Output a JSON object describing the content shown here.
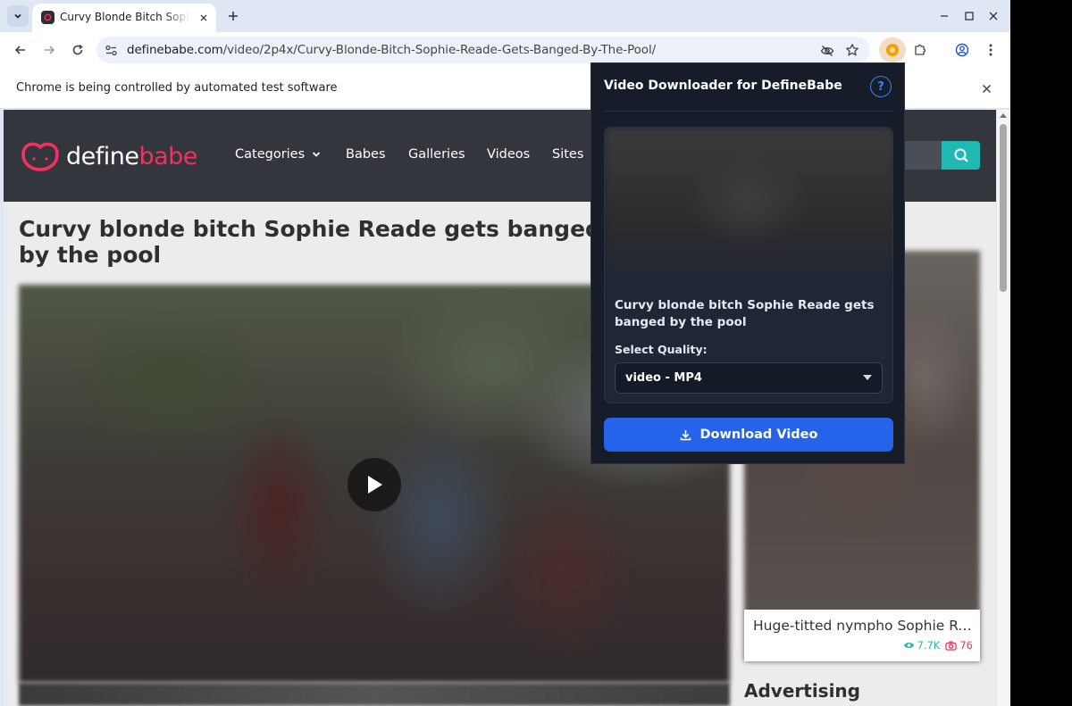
{
  "browser": {
    "tab": {
      "title": "Curvy Blonde Bitch Sophie Reade Gets Banged By The Pool"
    },
    "omnibox": {
      "domain": "definebabe.com",
      "path": "/video/2p4x/Curvy-Blonde-Bitch-Sophie-Reade-Gets-Banged-By-The-Pool/"
    },
    "infobar": {
      "text": "Chrome is being controlled by automated test software"
    }
  },
  "site": {
    "logo": {
      "define": "define",
      "babe": "babe"
    },
    "nav": [
      {
        "label": "Categories"
      },
      {
        "label": "Babes"
      },
      {
        "label": "Galleries"
      },
      {
        "label": "Videos"
      },
      {
        "label": "Sites"
      }
    ],
    "page_title": "Curvy blonde bitch Sophie Reade gets banged by the pool",
    "sidebar_card": {
      "title": "Huge-titted nympho Sophie Reade",
      "views": "7.7K",
      "photos": "76"
    },
    "advertising": "Advertising"
  },
  "popup": {
    "title": "Video Downloader for DefineBabe",
    "help": "?",
    "video_title": "Curvy blonde bitch Sophie Reade gets banged by the pool",
    "quality_label": "Select Quality:",
    "quality_value": "video - MP4",
    "download_label": "Download Video"
  },
  "colors": {
    "brand_pink": "#f0325f",
    "brand_teal": "#1fb8b3",
    "popup_bg": "#171d28",
    "download_blue": "#2563eb"
  }
}
